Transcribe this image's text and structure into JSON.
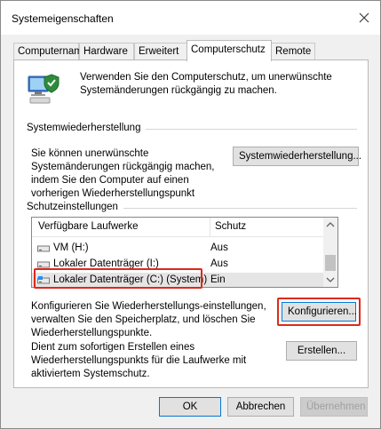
{
  "window": {
    "title": "Systemeigenschaften"
  },
  "tabs": [
    {
      "label": "Computername"
    },
    {
      "label": "Hardware"
    },
    {
      "label": "Erweitert"
    },
    {
      "label": "Computerschutz"
    },
    {
      "label": "Remote"
    }
  ],
  "intro": {
    "text": "Verwenden Sie den Computerschutz, um unerwünschte Systemänderungen rückgängig zu machen."
  },
  "restore": {
    "group_label": "Systemwiederherstellung",
    "text": "Sie können unerwünschte Systemänderungen rückgängig machen, indem Sie den Computer auf einen vorherigen Wiederherstellungspunkt zurücksetzen.",
    "button": "Systemwiederherstellung..."
  },
  "protection": {
    "group_label": "Schutzeinstellungen",
    "columns": {
      "drive": "Verfügbare Laufwerke",
      "state": "Schutz"
    },
    "drives": [
      {
        "name": "VM (H:)",
        "state": "Aus",
        "icon": "drive-icon"
      },
      {
        "name": "Lokaler Datenträger (I:)",
        "state": "Aus",
        "icon": "drive-icon"
      },
      {
        "name": "Lokaler Datenträger (C:) (System)",
        "state": "Ein",
        "icon": "system-drive-icon"
      }
    ],
    "config_text": "Konfigurieren Sie Wiederherstellungs-einstellungen, verwalten Sie den Speicherplatz, und löschen Sie Wiederherstellungspunkte.",
    "config_button": "Konfigurieren...",
    "create_text": "Dient zum sofortigen Erstellen eines Wiederherstellungspunkts für die Laufwerke mit aktiviertem Systemschutz.",
    "create_button": "Erstellen..."
  },
  "footer": {
    "ok": "OK",
    "cancel": "Abbrechen",
    "apply": "Übernehmen"
  },
  "colors": {
    "highlight": "#e0281b",
    "accent": "#0078d7"
  }
}
